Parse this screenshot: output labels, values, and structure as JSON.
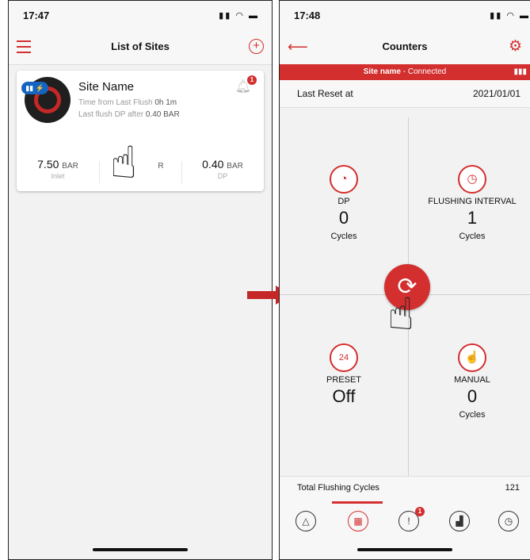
{
  "left_screen": {
    "status_time": "17:47",
    "title": "List of Sites",
    "card": {
      "site_name": "Site Name",
      "last_flush_label": "Time from Last Flush",
      "last_flush_value": "0h 1m",
      "last_dp_label": "Last flush DP after",
      "last_dp_value": "0.40 BAR",
      "notification_count": "1",
      "metrics": [
        {
          "value": "7.50",
          "unit": "BAR",
          "label": "Inlet"
        },
        {
          "value": "",
          "unit": "R",
          "label": ""
        },
        {
          "value": "0.40",
          "unit": "BAR",
          "label": "DP"
        }
      ]
    }
  },
  "right_screen": {
    "status_time": "17:48",
    "title": "Counters",
    "connection": {
      "site": "Site name",
      "status": "- Connected"
    },
    "last_reset_label": "Last Reset at",
    "last_reset_value": "2021/01/01",
    "counters": {
      "dp": {
        "label": "DP",
        "value": "0",
        "unit": "Cycles"
      },
      "flushing_interval": {
        "label": "FLUSHING INTERVAL",
        "value": "1",
        "unit": "Cycles"
      },
      "preset": {
        "label": "PRESET",
        "value": "Off",
        "icon_text": "24"
      },
      "manual": {
        "label": "MANUAL",
        "value": "0",
        "unit": "Cycles"
      }
    },
    "total_label": "Total Flushing Cycles",
    "total_value": "121",
    "alerts_badge": "1"
  },
  "colors": {
    "accent": "#d32f2f",
    "badge_blue": "#1565c0"
  }
}
